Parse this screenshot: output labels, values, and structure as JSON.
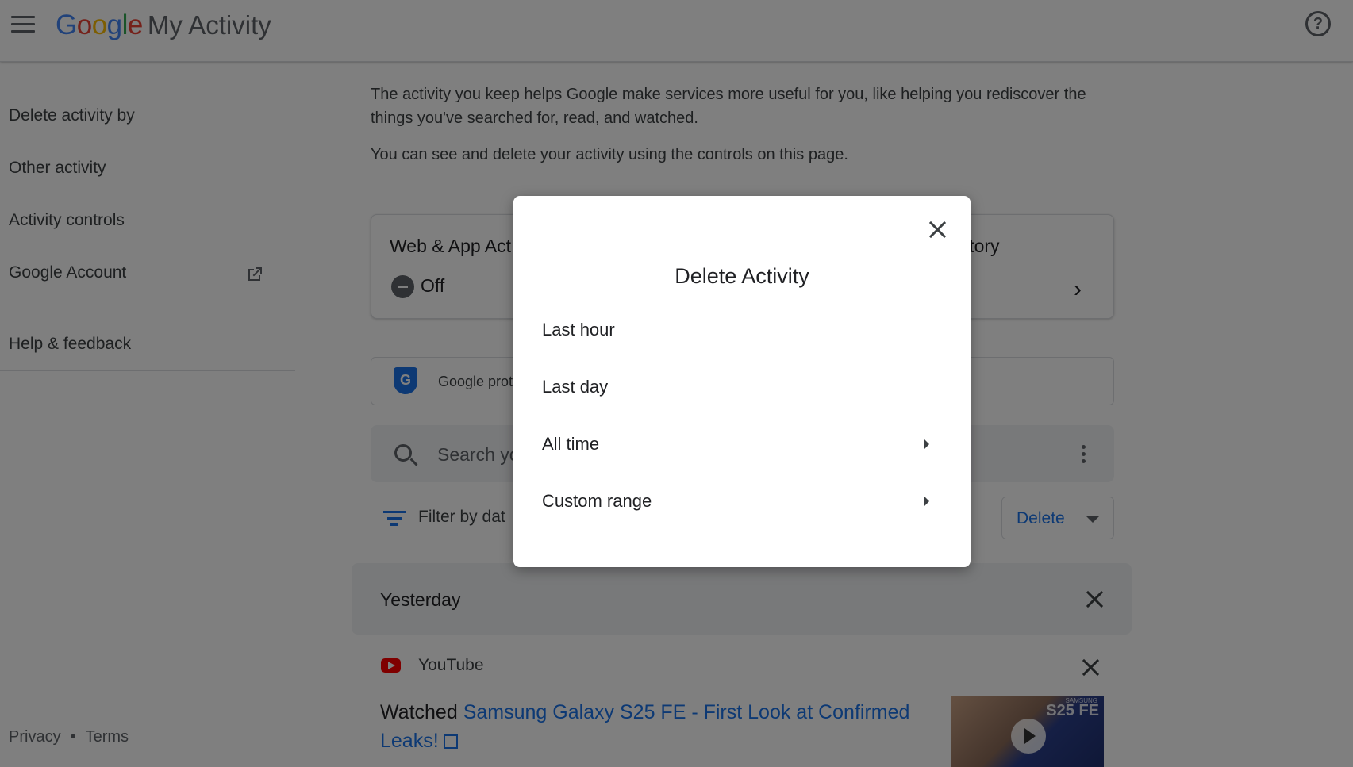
{
  "header": {
    "logo_letters": [
      "G",
      "o",
      "o",
      "g",
      "l",
      "e"
    ],
    "product": "My Activity"
  },
  "sidebar": {
    "items": [
      {
        "label": "Delete activity by"
      },
      {
        "label": "Other activity"
      },
      {
        "label": "Activity controls"
      },
      {
        "label": "Google Account"
      },
      {
        "label": "Help & feedback"
      }
    ],
    "footer": {
      "privacy": "Privacy",
      "separator": "•",
      "terms": "Terms"
    }
  },
  "main": {
    "intro": "The activity you keep helps Google make services more useful for you, like helping you rediscover the things you've searched for, read, and watched.",
    "intro2": "You can see and delete your activity using the controls on this page.",
    "card_left": {
      "title": "Web & App Act",
      "status": "Off"
    },
    "card_right": {
      "title": "History"
    },
    "protect": {
      "shield_letter": "G",
      "text": "Google prot"
    },
    "search": {
      "placeholder": "Search yo"
    },
    "filter": {
      "label": "Filter by dat"
    },
    "delete_button": "Delete",
    "day_group": "Yesterday",
    "entry": {
      "source": "YouTube",
      "prefix": "Watched",
      "title": "Samsung Galaxy S25 FE - First Look at Confirmed Leaks!",
      "thumb_label": "S25 FE",
      "thumb_sub": "SAMSUNG"
    }
  },
  "modal": {
    "title": "Delete Activity",
    "options": [
      {
        "label": "Last hour",
        "submenu": false
      },
      {
        "label": "Last day",
        "submenu": false
      },
      {
        "label": "All time",
        "submenu": true
      },
      {
        "label": "Custom range",
        "submenu": true
      }
    ]
  },
  "colors": {
    "accent": "#1a73e8",
    "scrim": "rgba(0,0,0,0.5)",
    "youtube": "#ff0000"
  }
}
